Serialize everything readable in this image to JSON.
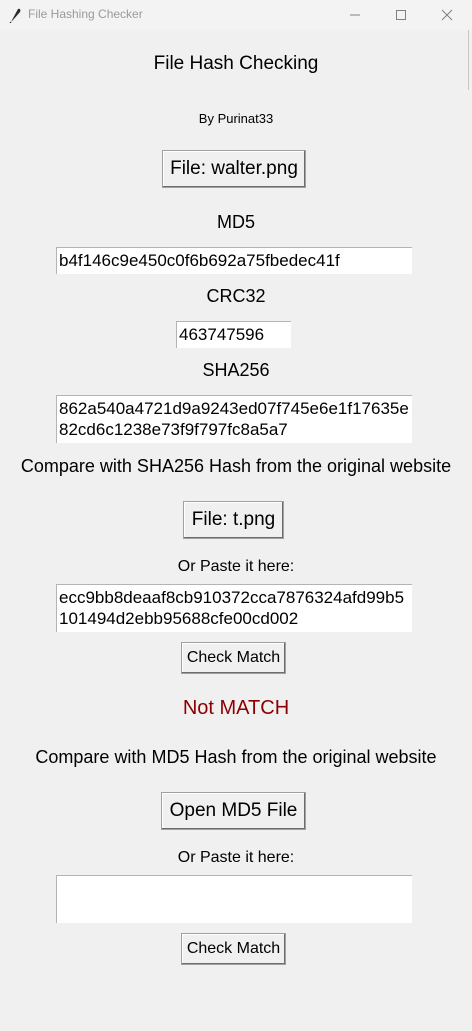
{
  "window": {
    "title": "File Hashing Checker",
    "icon": "feather-icon"
  },
  "app": {
    "heading": "File Hash Checking",
    "byline": "By Purinat33",
    "file_button": "File: walter.png",
    "md5_label": "MD5",
    "md5_value": "b4f146c9e450c0f6b692a75fbedec41f",
    "crc32_label": "CRC32",
    "crc32_value": "463747596",
    "sha256_label": "SHA256",
    "sha256_value": "862a540a4721d9a9243ed07f745e6e1f17635e82cd6c1238e73f9f797fc8a5a7"
  },
  "sha_compare": {
    "heading": "Compare with SHA256 Hash from the original website",
    "file_button": "File: t.png",
    "paste_label": "Or Paste it here:",
    "paste_value": "ecc9bb8deaaf8cb910372cca7876324afd99b5101494d2ebb95688cfe00cd002",
    "check_button": "Check Match",
    "result": "Not MATCH",
    "result_color": "#8b0000"
  },
  "md5_compare": {
    "heading": "Compare with MD5 Hash from the original website",
    "file_button": "Open MD5 File",
    "paste_label": "Or Paste it here:",
    "paste_value": "",
    "check_button": "Check Match"
  }
}
